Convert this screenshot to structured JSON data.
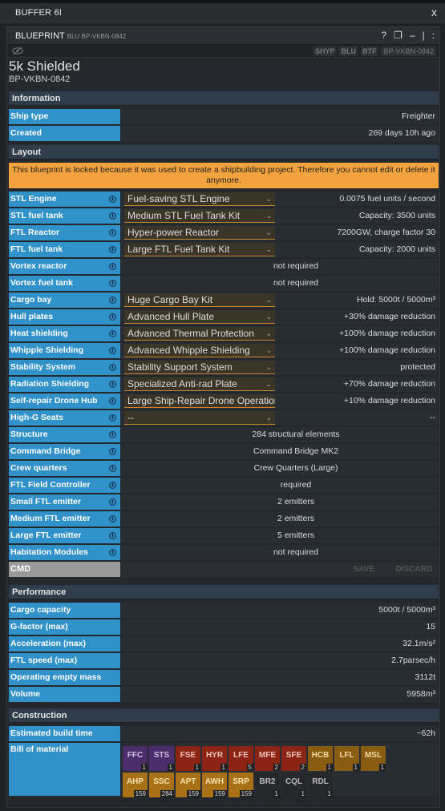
{
  "window": {
    "title": "BUFFER 6I",
    "close": "x"
  },
  "tile": {
    "command": "BLUEPRINT",
    "command_sub": "BLU BP-VKBN-0842",
    "controls": [
      "?",
      "❐",
      "–",
      "|",
      ":"
    ],
    "tags": [
      "SHYP",
      "BLU",
      "BTF"
    ],
    "tag_value": "BP-VKBN-0842"
  },
  "blueprint": {
    "name": "5k Shielded",
    "code": "BP-VKBN-0842"
  },
  "sections": {
    "information": "Information",
    "layout": "Layout",
    "performance": "Performance",
    "construction": "Construction"
  },
  "information": [
    {
      "label": "Ship type",
      "value": "Freighter"
    },
    {
      "label": "Created",
      "value": "269 days 10h ago"
    }
  ],
  "locked_notice": "This blueprint is locked because it was used to create a shipbuilding project. Therefore you cannot edit or delete it anymore.",
  "layout_rows": [
    {
      "label": "STL Engine",
      "select": "Fuel-saving STL Engine",
      "value": "0.0075 fuel units / second"
    },
    {
      "label": "STL fuel tank",
      "select": "Medium STL Fuel Tank Kit",
      "value": "Capacity: 3500 units"
    },
    {
      "label": "FTL Reactor",
      "select": "Hyper-power Reactor",
      "value": "7200GW, charge factor 30"
    },
    {
      "label": "FTL fuel tank",
      "select": "Large FTL Fuel Tank Kit",
      "value": "Capacity: 2000 units"
    },
    {
      "label": "Vortex reactor",
      "select": null,
      "value": "not required"
    },
    {
      "label": "Vortex fuel tank",
      "select": null,
      "value": "not required"
    },
    {
      "label": "Cargo bay",
      "select": "Huge Cargo Bay Kit",
      "value": "Hold: 5000t / 5000m³"
    },
    {
      "label": "Hull plates",
      "select": "Advanced Hull Plate",
      "value": "+30% damage reduction"
    },
    {
      "label": "Heat shielding",
      "select": "Advanced Thermal Protection",
      "value": "+100% damage reduction"
    },
    {
      "label": "Whipple Shielding",
      "select": "Advanced Whipple Shielding",
      "value": "+100% damage reduction"
    },
    {
      "label": "Stability System",
      "select": "Stability Support System",
      "value": "protected"
    },
    {
      "label": "Radiation Shielding",
      "select": "Specialized Anti-rad Plate",
      "value": "+70% damage reduction"
    },
    {
      "label": "Self-repair Drone Hub",
      "select": "Large Ship-Repair Drone Operations Center",
      "value": "+10% damage reduction"
    },
    {
      "label": "High-G Seats",
      "select": "--",
      "value": "--"
    },
    {
      "label": "Structure",
      "select": null,
      "value": "284 structural elements"
    },
    {
      "label": "Command Bridge",
      "select": null,
      "value": "Command Bridge MK2"
    },
    {
      "label": "Crew quarters",
      "select": null,
      "value": "Crew Quarters (Large)"
    },
    {
      "label": "FTL Field Controller",
      "select": null,
      "value": "required"
    },
    {
      "label": "Small FTL emitter",
      "select": null,
      "value": "2 emitters"
    },
    {
      "label": "Medium FTL emitter",
      "select": null,
      "value": "2 emitters"
    },
    {
      "label": "Large FTL emitter",
      "select": null,
      "value": "5 emitters"
    },
    {
      "label": "Habitation Modules",
      "select": null,
      "value": "not required"
    }
  ],
  "cmd": {
    "label": "CMD",
    "save": "SAVE",
    "discard": "DISCARD"
  },
  "performance": [
    {
      "label": "Cargo capacity",
      "value": "5000t / 5000m³"
    },
    {
      "label": "G-factor (max)",
      "value": "15"
    },
    {
      "label": "Acceleration (max)",
      "value": "32.1m/s²"
    },
    {
      "label": "FTL speed (max)",
      "value": "2.7parsec/h"
    },
    {
      "label": "Operating empty mass",
      "value": "3112t"
    },
    {
      "label": "Volume",
      "value": "5958m³"
    }
  ],
  "construction": {
    "build_time_label": "Estimated build time",
    "build_time": "~62h",
    "bom_label": "Bill of material"
  },
  "materials": [
    {
      "ticker": "FFC",
      "count": "1",
      "bg": "#4b2d6b",
      "fg": "#cfc0e0"
    },
    {
      "ticker": "STS",
      "count": "1",
      "bg": "#4b2d6b",
      "fg": "#cfc0e0"
    },
    {
      "ticker": "FSE",
      "count": "1",
      "bg": "#8c2416",
      "fg": "#f1c3b8"
    },
    {
      "ticker": "HYR",
      "count": "1",
      "bg": "#8c2416",
      "fg": "#f1c3b8"
    },
    {
      "ticker": "LFE",
      "count": "5",
      "bg": "#8c2416",
      "fg": "#f1c3b8"
    },
    {
      "ticker": "MFE",
      "count": "2",
      "bg": "#8c2416",
      "fg": "#f1c3b8"
    },
    {
      "ticker": "SFE",
      "count": "2",
      "bg": "#8c2416",
      "fg": "#f1c3b8"
    },
    {
      "ticker": "HCB",
      "count": "1",
      "bg": "#8a5c12",
      "fg": "#f3d9a6"
    },
    {
      "ticker": "LFL",
      "count": "1",
      "bg": "#8a5c12",
      "fg": "#f3d9a6"
    },
    {
      "ticker": "MSL",
      "count": "1",
      "bg": "#8a5c12",
      "fg": "#f3d9a6"
    },
    {
      "ticker": "AHP",
      "count": "159",
      "bg": "#a87118",
      "fg": "#fbe3b0"
    },
    {
      "ticker": "SSC",
      "count": "284",
      "bg": "#a87118",
      "fg": "#fbe3b0"
    },
    {
      "ticker": "APT",
      "count": "159",
      "bg": "#a87118",
      "fg": "#fbe3b0"
    },
    {
      "ticker": "AWH",
      "count": "159",
      "bg": "#a87118",
      "fg": "#fbe3b0"
    },
    {
      "ticker": "SRP",
      "count": "159",
      "bg": "#a87118",
      "fg": "#fbe3b0"
    },
    {
      "ticker": "BR2",
      "count": "1",
      "bg": "#26282b",
      "fg": "#bdbdbd"
    },
    {
      "ticker": "CQL",
      "count": "1",
      "bg": "#26282b",
      "fg": "#bdbdbd"
    },
    {
      "ticker": "RDL",
      "count": "1",
      "bg": "#26282b",
      "fg": "#bdbdbd"
    }
  ]
}
